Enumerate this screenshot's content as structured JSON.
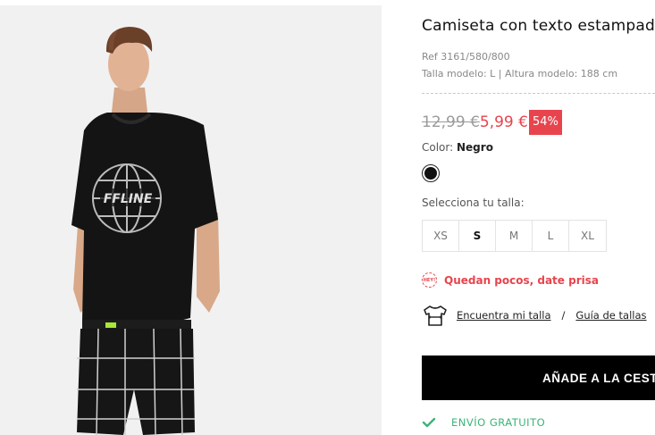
{
  "product": {
    "title": "Camiseta con texto estampado",
    "ref": "Ref 3161/580/800",
    "model_info": "Talla modelo: L | Altura modelo: 188 cm",
    "old_price": "12,99 €",
    "new_price": "5,99 €",
    "discount": "54%",
    "color_label": "Color:",
    "color_value": "Negro",
    "swatch_color": "#111111",
    "size_label": "Selecciona tu talla:",
    "sizes": [
      "XS",
      "S",
      "M",
      "L",
      "XL"
    ],
    "selected_size": "S",
    "shirt_graphic_text": "FFLINE"
  },
  "stock": {
    "badge": "HEY!",
    "text": "Quedan pocos, date prisa"
  },
  "size_help": {
    "finder_link": "Encuentra mi talla",
    "separator": "/",
    "guide_link": "Guía de tallas"
  },
  "cart": {
    "add_label": "AÑADE A LA CESTA"
  },
  "shipping": {
    "text": "ENVÍO GRATUITO"
  },
  "colors": {
    "accent_red": "#e8444d",
    "success_green": "#3bb37a",
    "button_black": "#000000"
  }
}
